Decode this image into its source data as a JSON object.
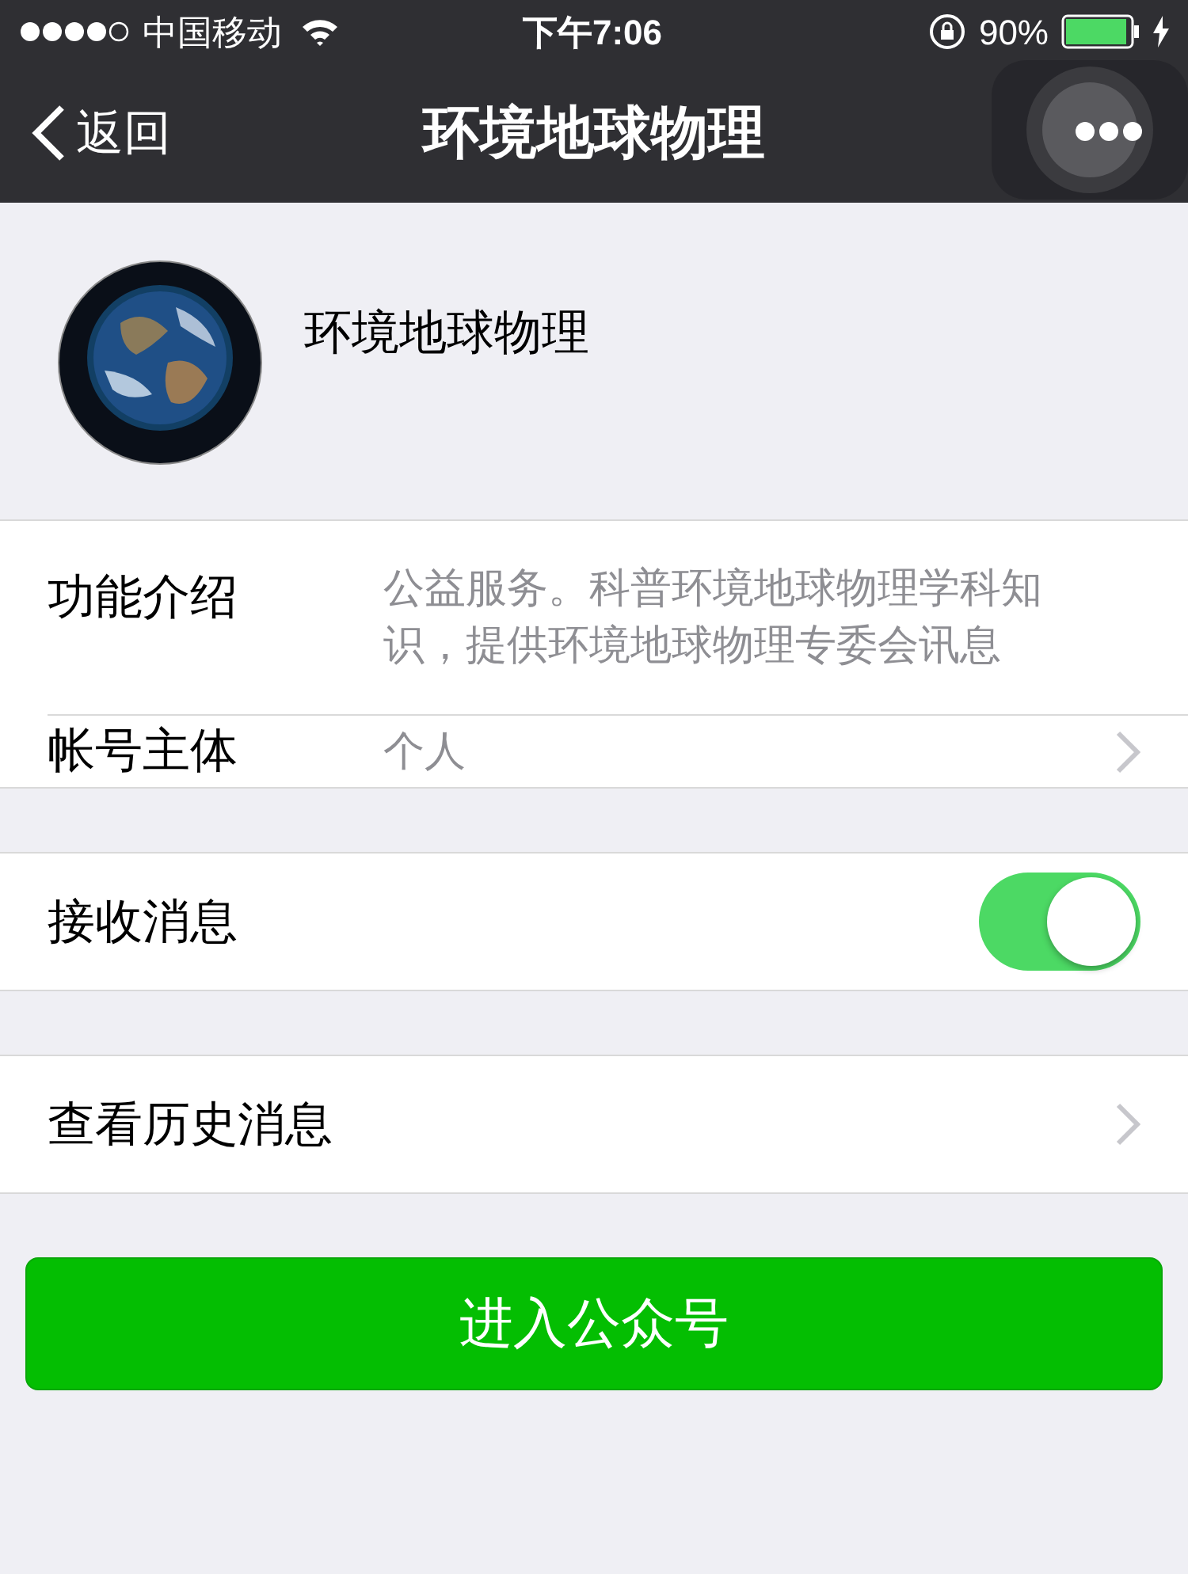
{
  "status_bar": {
    "carrier": "中国移动",
    "time": "下午7:06",
    "battery_percent": "90%"
  },
  "nav_bar": {
    "back_label": "返回",
    "title": "环境地球物理"
  },
  "profile": {
    "name": "环境地球物理"
  },
  "groups": [
    [
      {
        "kind": "info",
        "label": "功能介绍",
        "value": "公益服务。科普环境地球物理学科知识，提供环境地球物理专委会讯息"
      },
      {
        "kind": "link",
        "label": "帐号主体",
        "value": "个人"
      }
    ],
    [
      {
        "kind": "toggle",
        "label": "接收消息",
        "on": true
      }
    ],
    [
      {
        "kind": "link",
        "label": "查看历史消息"
      }
    ]
  ],
  "primary_button": "进入公众号"
}
